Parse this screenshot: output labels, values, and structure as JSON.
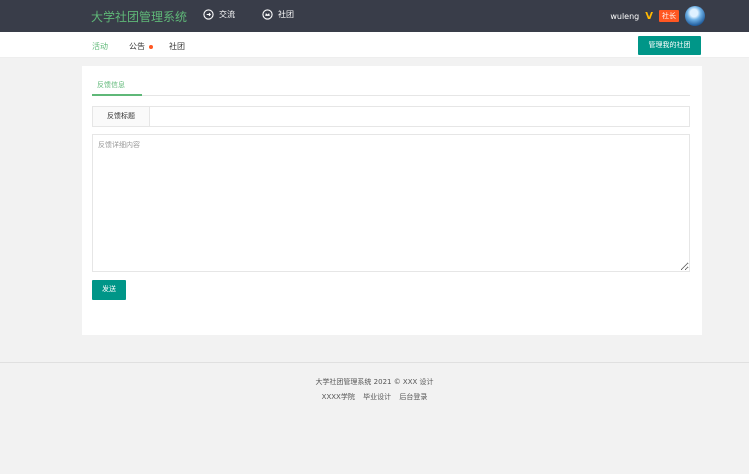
{
  "topbar": {
    "logo": "大学社团管理系统",
    "nav": [
      {
        "label": "交流",
        "icon": "exchange-icon"
      },
      {
        "label": "社团",
        "icon": "club-icon"
      }
    ],
    "user": {
      "name": "wuleng",
      "vip": "V",
      "badge": "社长"
    }
  },
  "subnav": {
    "items": [
      "活动",
      "公告",
      "社团"
    ],
    "manage_button": "管理我的社团"
  },
  "form": {
    "tab": "反馈信息",
    "title_label": "反馈标题",
    "title_value": "",
    "content_placeholder": "反馈详细内容",
    "submit_label": "发送"
  },
  "footer": {
    "line1": "大学社团管理系统  2021 ©  XXX 设计",
    "links": [
      "XXXX学院",
      "毕业设计",
      "后台登录"
    ]
  },
  "colors": {
    "topbar_bg": "#393d49",
    "accent_green": "#5fb878",
    "button_teal": "#009688",
    "notice_dot": "#ff5722",
    "vip_gold": "#ffb800"
  }
}
